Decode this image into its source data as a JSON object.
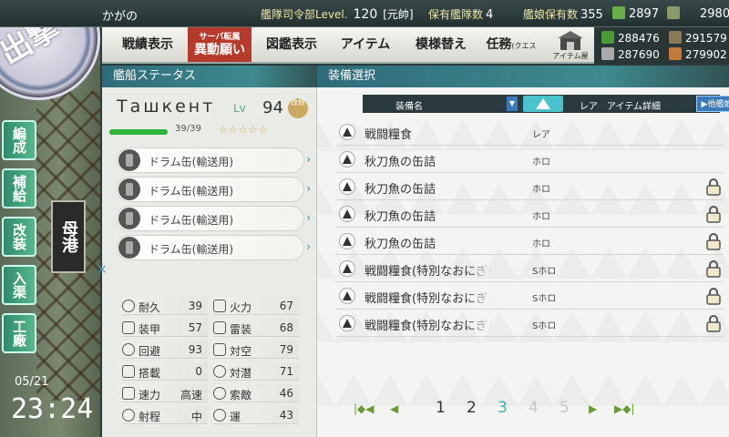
{
  "header": {
    "admiral_name": "かがの",
    "hq_label": "艦隊司令部Level.",
    "hq_level": "120",
    "rank": "[元帥]",
    "ship_count_label": "保有艦隊数",
    "ship_count": "4",
    "equip_count_label": "艦娘保有数",
    "equip_count": "355",
    "bucket": "2897",
    "devmat": "2980"
  },
  "menu": {
    "items": [
      "戦績表示",
      "サーバ転属",
      "異動願い",
      "図鑑表示",
      "アイテム",
      "模様替え",
      "任務"
    ],
    "quest_sub": "(クエスト)",
    "item_house": "アイテム屋"
  },
  "resources": {
    "fuel": "288476",
    "ammo": "291579",
    "steel": "287690",
    "bauxite": "279902"
  },
  "sidebar": {
    "sortie": "出撃",
    "buttons": [
      "編成",
      "補給",
      "改装",
      "入渠",
      "工廠"
    ],
    "port": "母港",
    "date": "05/21",
    "time": "23:24"
  },
  "ship_panel": {
    "header": "艦船ステータス",
    "name": "Ташкент",
    "lv_label": "Lv",
    "level": "94",
    "kai_badge": "改修",
    "hp": "39/39",
    "hp_fraction": 1.0,
    "stars": "☆☆☆☆☆",
    "slots": [
      "ドラム缶(輸送用)",
      "ドラム缶(輸送用)",
      "ドラム缶(輸送用)",
      "ドラム缶(輸送用)"
    ],
    "remove": "×",
    "stats": [
      {
        "label": "耐久",
        "value": "39"
      },
      {
        "label": "火力",
        "value": "67"
      },
      {
        "label": "装甲",
        "value": "57"
      },
      {
        "label": "雷装",
        "value": "68"
      },
      {
        "label": "回避",
        "value": "93"
      },
      {
        "label": "対空",
        "value": "79"
      },
      {
        "label": "搭載",
        "value": "0"
      },
      {
        "label": "対潜",
        "value": "71"
      },
      {
        "label": "速力",
        "value": "高速"
      },
      {
        "label": "索敵",
        "value": "46"
      },
      {
        "label": "射程",
        "value": "中"
      },
      {
        "label": "運",
        "value": "43"
      }
    ]
  },
  "equip_panel": {
    "header": "装備選択",
    "col_name": "装備名",
    "col_rarity": "レア",
    "col_detail": "アイテム詳細",
    "other_ship_btn": "▶他艦娘装備中",
    "rows": [
      {
        "name": "戦闘糧食",
        "rarity": "レア",
        "locked": false
      },
      {
        "name": "秋刀魚の缶詰",
        "rarity": "ホロ",
        "locked": false
      },
      {
        "name": "秋刀魚の缶詰",
        "rarity": "ホロ",
        "locked": true
      },
      {
        "name": "秋刀魚の缶詰",
        "rarity": "ホロ",
        "locked": true
      },
      {
        "name": "秋刀魚の缶詰",
        "rarity": "ホロ",
        "locked": true
      },
      {
        "name": "戦闘糧食(特別なおにぎり)",
        "rarity": "Sホロ",
        "locked": true
      },
      {
        "name": "戦闘糧食(特別なおにぎり)",
        "rarity": "Sホロ",
        "locked": true
      },
      {
        "name": "戦闘糧食(特別なおにぎり)",
        "rarity": "Sホロ",
        "locked": true
      }
    ],
    "pages": [
      "1",
      "2",
      "3",
      "4",
      "5"
    ],
    "current_page": "3"
  },
  "colors": {
    "accent": "#3ab0b8",
    "header_teal": "#2f6b7a",
    "hp_green": "#2fb33a",
    "special_btn_red": "#b63a2c"
  }
}
